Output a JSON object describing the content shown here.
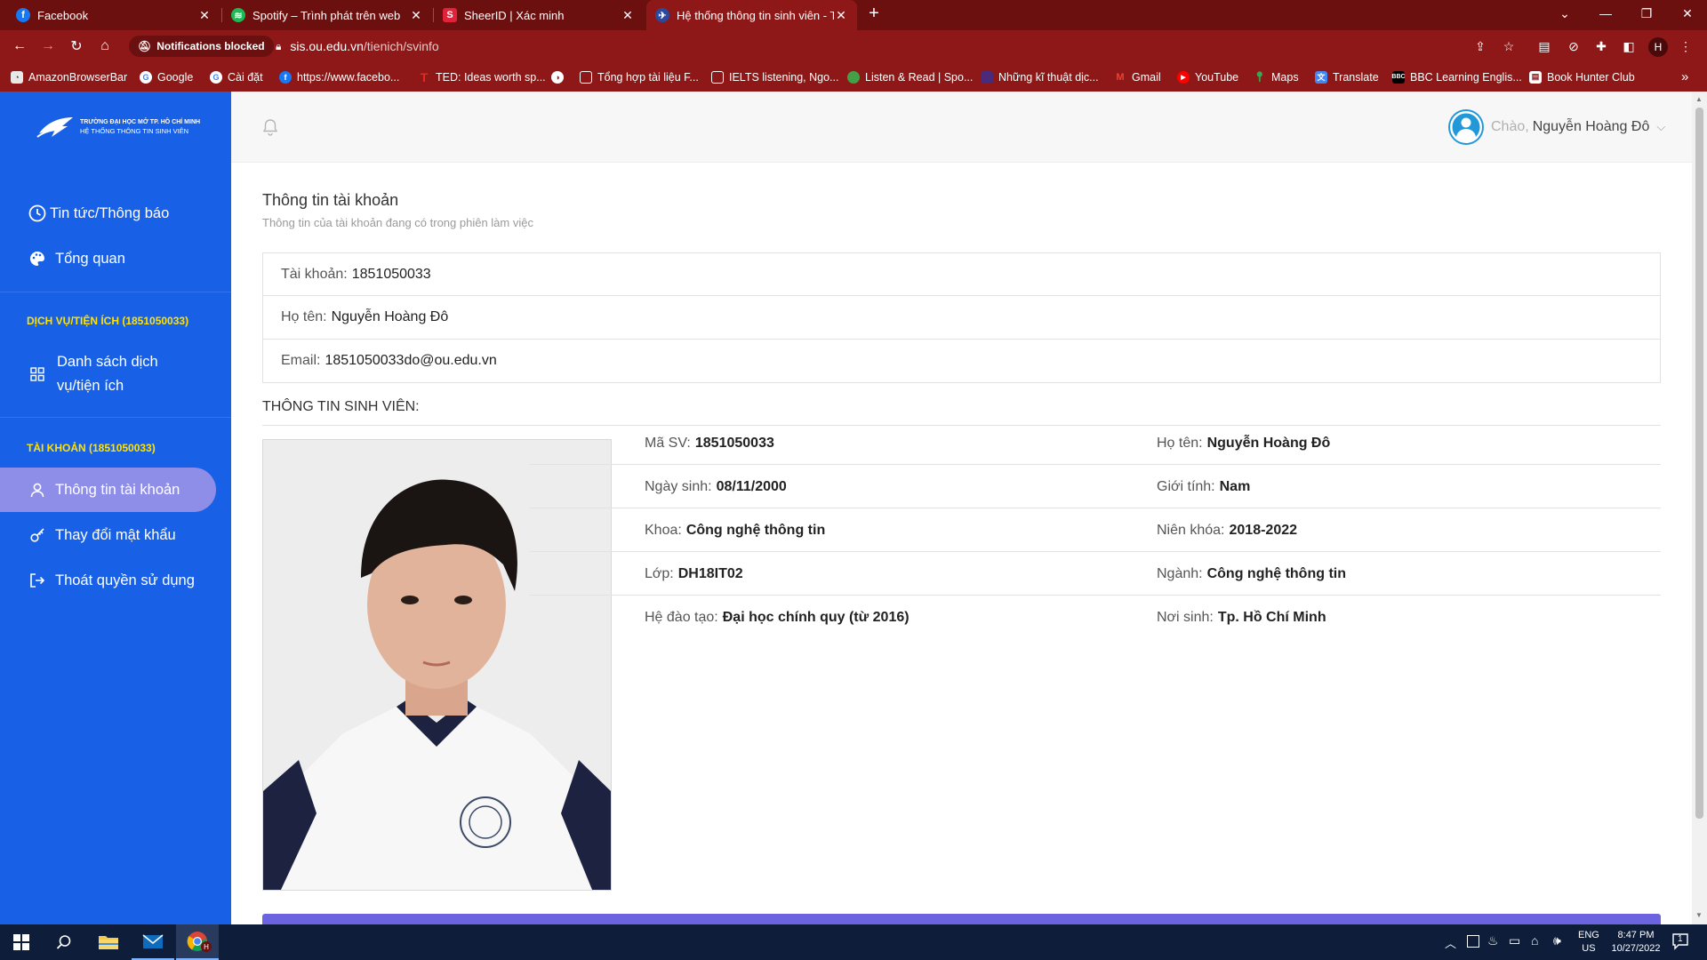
{
  "browser": {
    "tabs": [
      {
        "title": "Facebook",
        "favicon_color": "#1877f2",
        "favicon_glyph": "f"
      },
      {
        "title": "Spotify – Trình phát trên web",
        "favicon_color": "#1db954",
        "favicon_glyph": "≋"
      },
      {
        "title": "SheerID | Xác minh",
        "favicon_color": "#e2223b",
        "favicon_glyph": "S"
      },
      {
        "title": "Hệ thống thông tin sinh viên - Tr",
        "favicon_color": "#2a4aa0",
        "favicon_glyph": "✈",
        "active": true
      }
    ],
    "new_tab_icon": "+",
    "window_controls": {
      "chevron": "⌄",
      "minimize": "—",
      "restore": "❐",
      "close": "✕"
    },
    "notifications_chip": "Notifications blocked",
    "url": {
      "host": "sis.ou.edu.vn",
      "path": "/tienich/svinfo"
    },
    "profile_letter": "H",
    "bookmarks": [
      {
        "label": "AmazonBrowserBar",
        "icon_color": "#e8e8e8",
        "glyph": "◔"
      },
      {
        "label": "Google",
        "icon_color": "#ffffff",
        "glyph": "G"
      },
      {
        "label": "Cài đặt",
        "icon_color": "#ffffff",
        "glyph": "G"
      },
      {
        "label": "https://www.facebo...",
        "icon_color": "#1877f2",
        "glyph": "f"
      },
      {
        "label": "TED: Ideas worth sp...",
        "icon_color": "#e62b1e",
        "glyph": "T"
      },
      {
        "label": "",
        "icon_color": "#ffffff",
        "glyph": "◑"
      },
      {
        "label": "Tổng hợp tài liệu F...",
        "icon_color": "#c62828",
        "glyph": "▣"
      },
      {
        "label": "IELTS listening, Ngo...",
        "icon_color": "#c62828",
        "glyph": "▣"
      },
      {
        "label": "Listen & Read | Spo...",
        "icon_color": "#43a047",
        "glyph": "●"
      },
      {
        "label": "Những kĩ thuật dịc...",
        "icon_color": "#4a2a7a",
        "glyph": "▦"
      },
      {
        "label": "Gmail",
        "icon_color": "#ffffff",
        "glyph": "M"
      },
      {
        "label": "YouTube",
        "icon_color": "#ff0000",
        "glyph": "▶"
      },
      {
        "label": "Maps",
        "icon_color": "#34a853",
        "glyph": "⬤"
      },
      {
        "label": "Translate",
        "icon_color": "#4285f4",
        "glyph": "文"
      },
      {
        "label": "BBC Learning Englis...",
        "icon_color": "#000000",
        "glyph": "B"
      },
      {
        "label": "Book Hunter Club",
        "icon_color": "#ffffff",
        "glyph": "▤"
      }
    ],
    "bookmarks_overflow": "»"
  },
  "sidebar": {
    "logo_line1": "TRƯỜNG ĐẠI HỌC MỞ TP. HỒ CHÍ MINH",
    "logo_line2": "HỆ THỐNG THÔNG TIN SINH VIÊN",
    "nav": [
      {
        "label": "Tin tức/Thông báo",
        "icon": "clock-icon"
      },
      {
        "label": "Tổng quan",
        "icon": "palette-icon"
      }
    ],
    "section_services": "DỊCH VỤ/TIỆN ÍCH (1851050033)",
    "services_item_line1": "Danh sách dịch",
    "services_item_line2": "vụ/tiện ích",
    "section_account": "TÀI KHOẢN (1851050033)",
    "account_items": [
      {
        "label": "Thông tin tài khoản",
        "icon": "user-icon",
        "active": true
      },
      {
        "label": "Thay đổi mật khẩu",
        "icon": "key-icon"
      },
      {
        "label": "Thoát quyền sử dụng",
        "icon": "logout-icon"
      }
    ],
    "bg_color": "#1860e6",
    "active_color": "#8e8de8",
    "heading_color": "#ffe200"
  },
  "header": {
    "greeting": "Chào,",
    "user_name": "Nguyễn Hoàng Đô"
  },
  "account": {
    "title": "Thông tin tài khoản",
    "subtitle": "Thông tin của tài khoản đang có trong phiên làm việc",
    "rows": [
      {
        "label": "Tài khoản:",
        "value": "1851050033"
      },
      {
        "label": "Họ tên:",
        "value": "Nguyễn Hoàng Đô"
      },
      {
        "label": "Email:",
        "value": "1851050033do@ou.edu.vn"
      }
    ]
  },
  "student": {
    "section_title": "THÔNG TIN SINH VIÊN:",
    "left": [
      {
        "label": "Mã SV:",
        "value": "1851050033"
      },
      {
        "label": "Ngày sinh:",
        "value": "08/11/2000"
      },
      {
        "label": "Khoa:",
        "value": "Công nghệ thông tin"
      },
      {
        "label": "Lớp:",
        "value": "DH18IT02"
      },
      {
        "label": "Hệ đào tạo:",
        "value": "Đại học chính quy (từ 2016)"
      }
    ],
    "right": [
      {
        "label": "Họ tên:",
        "value": "Nguyễn Hoàng Đô"
      },
      {
        "label": "Giới tính:",
        "value": "Nam"
      },
      {
        "label": "Niên khóa:",
        "value": "2018-2022"
      },
      {
        "label": "Ngành:",
        "value": "Công nghệ thông tin"
      },
      {
        "label": "Nơi sinh:",
        "value": "Tp. Hồ Chí Minh"
      }
    ]
  },
  "taskbar": {
    "lang_top": "ENG",
    "lang_bottom": "US",
    "time": "8:47 PM",
    "date": "10/27/2022",
    "notification_count": "1",
    "chrome_profile_letter": "H",
    "system_tray_chevron": "︿"
  }
}
